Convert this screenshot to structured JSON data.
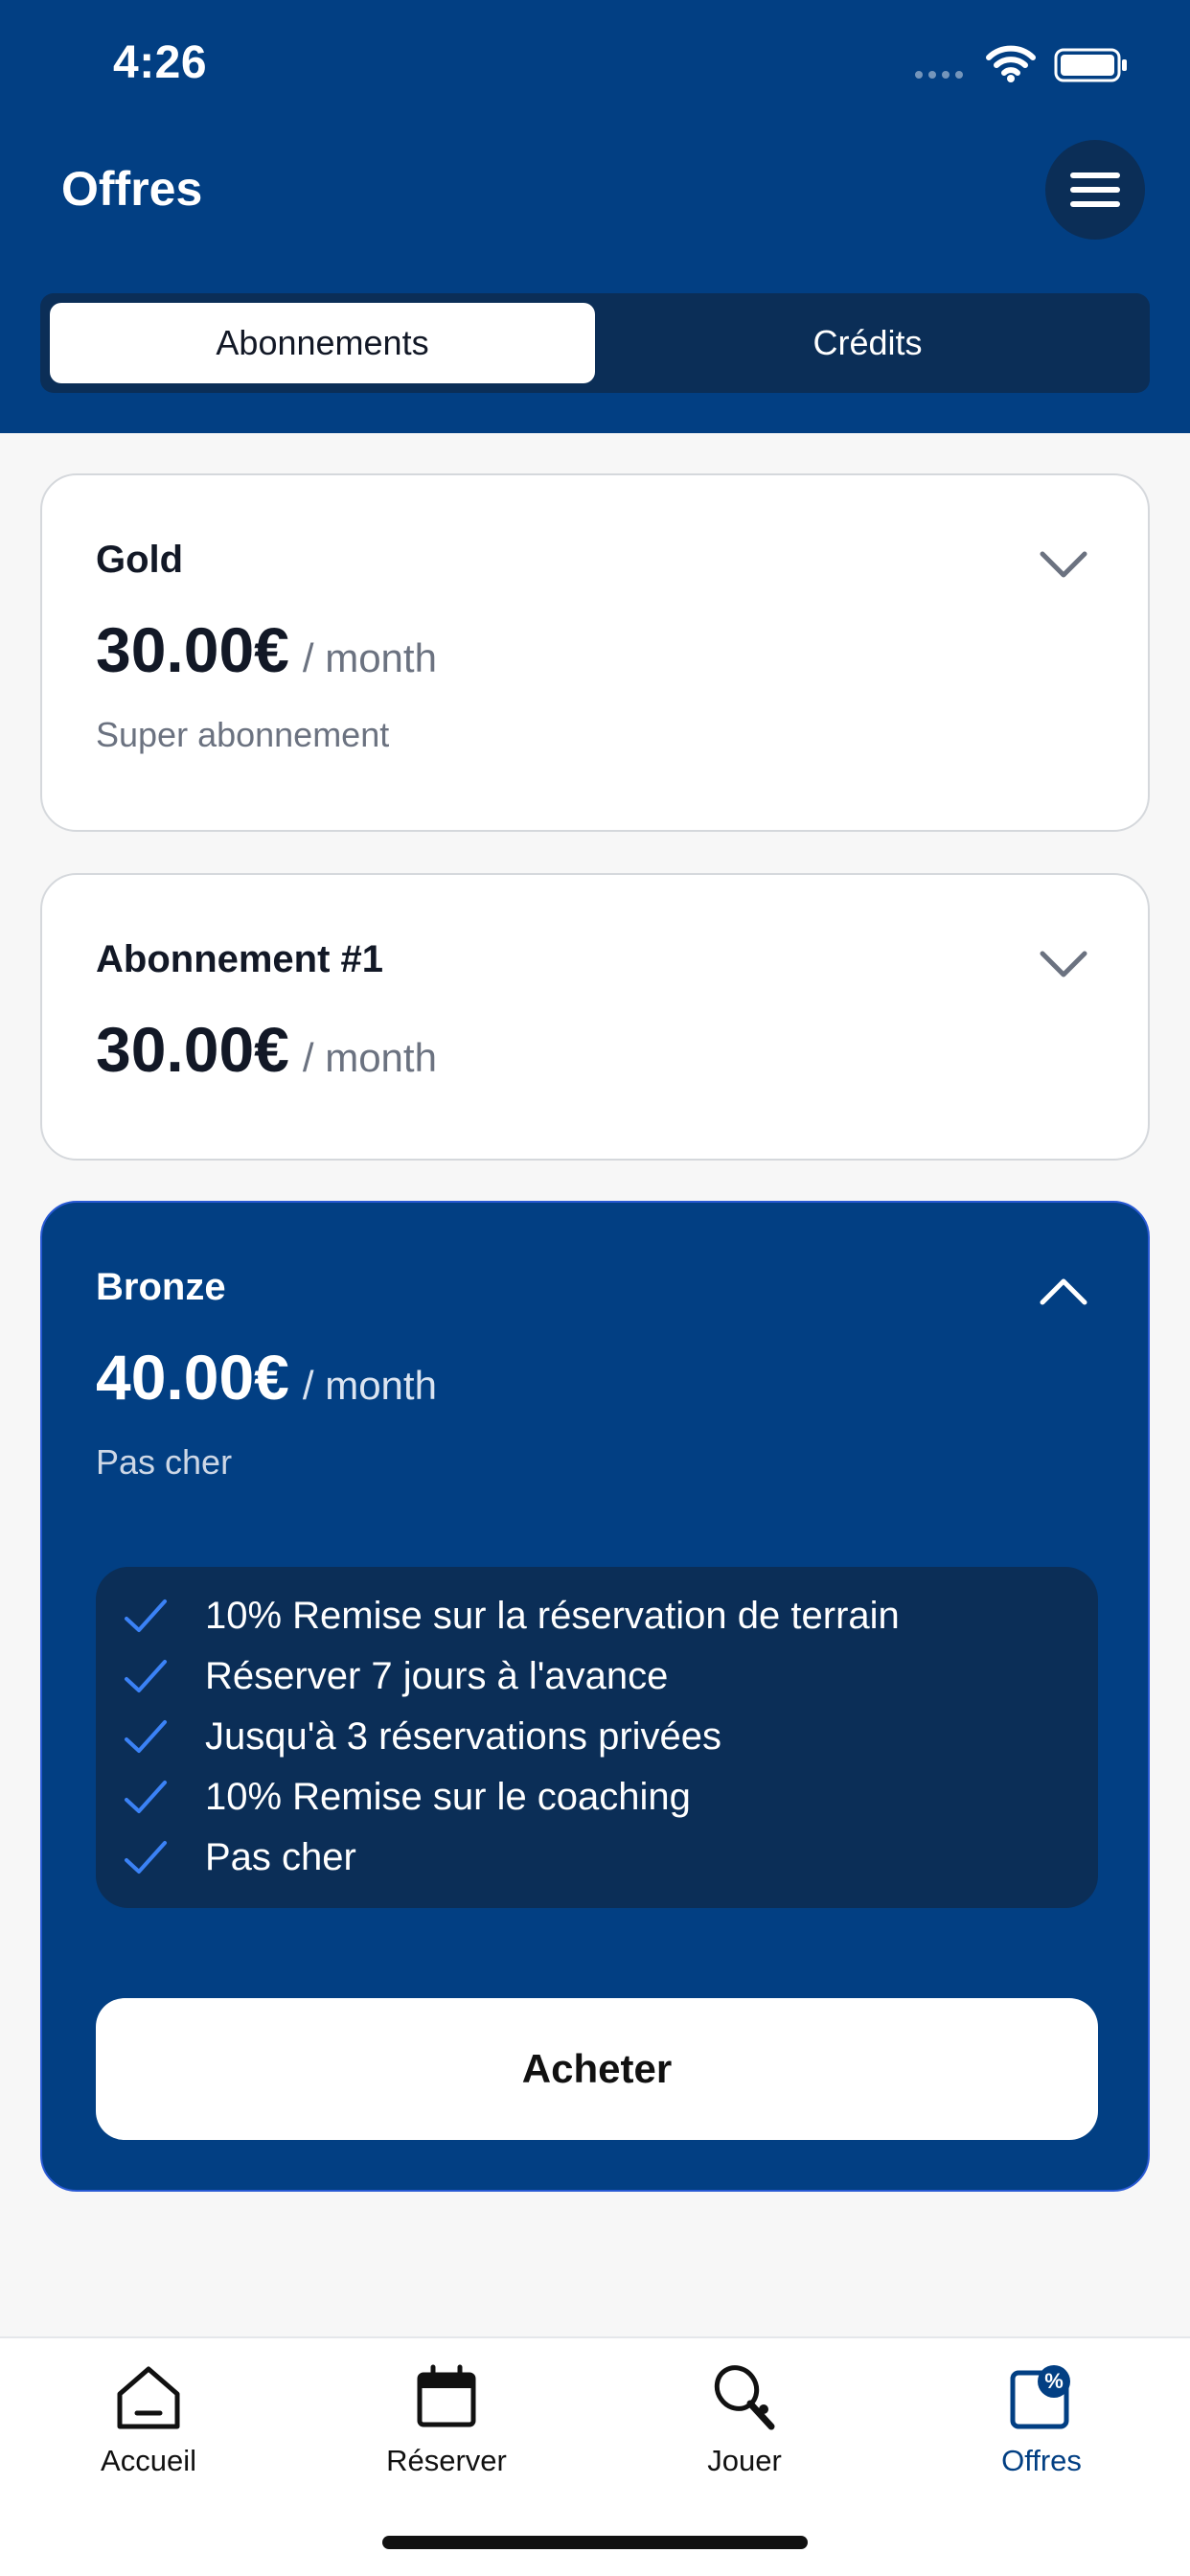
{
  "status_bar": {
    "time": "4:26"
  },
  "header": {
    "title": "Offres"
  },
  "tabs": [
    {
      "label": "Abonnements",
      "active": true
    },
    {
      "label": "Crédits",
      "active": false
    }
  ],
  "plans": [
    {
      "name": "Gold",
      "price": "30.00€",
      "period": "/ month",
      "description": "Super abonnement",
      "expanded": false
    },
    {
      "name": "Abonnement #1",
      "price": "30.00€",
      "period": "/ month",
      "description": "",
      "expanded": false
    },
    {
      "name": "Bronze",
      "price": "40.00€",
      "period": "/ month",
      "description": "Pas cher",
      "expanded": true,
      "features": [
        "10% Remise sur la réservation de terrain",
        "Réserver 7 jours à l'avance",
        "Jusqu'à 3 réservations privées",
        "10% Remise sur le coaching",
        "Pas cher"
      ],
      "buy_label": "Acheter"
    }
  ],
  "tabbar": [
    {
      "label": "Accueil",
      "icon": "home-icon",
      "active": false
    },
    {
      "label": "Réserver",
      "icon": "calendar-icon",
      "active": false
    },
    {
      "label": "Jouer",
      "icon": "racket-icon",
      "active": false
    },
    {
      "label": "Offres",
      "icon": "offers-icon",
      "active": true
    }
  ],
  "colors": {
    "primary": "#023f83",
    "panel": "#0b2e57",
    "check": "#3b82f6",
    "background": "#f7f7f7"
  }
}
